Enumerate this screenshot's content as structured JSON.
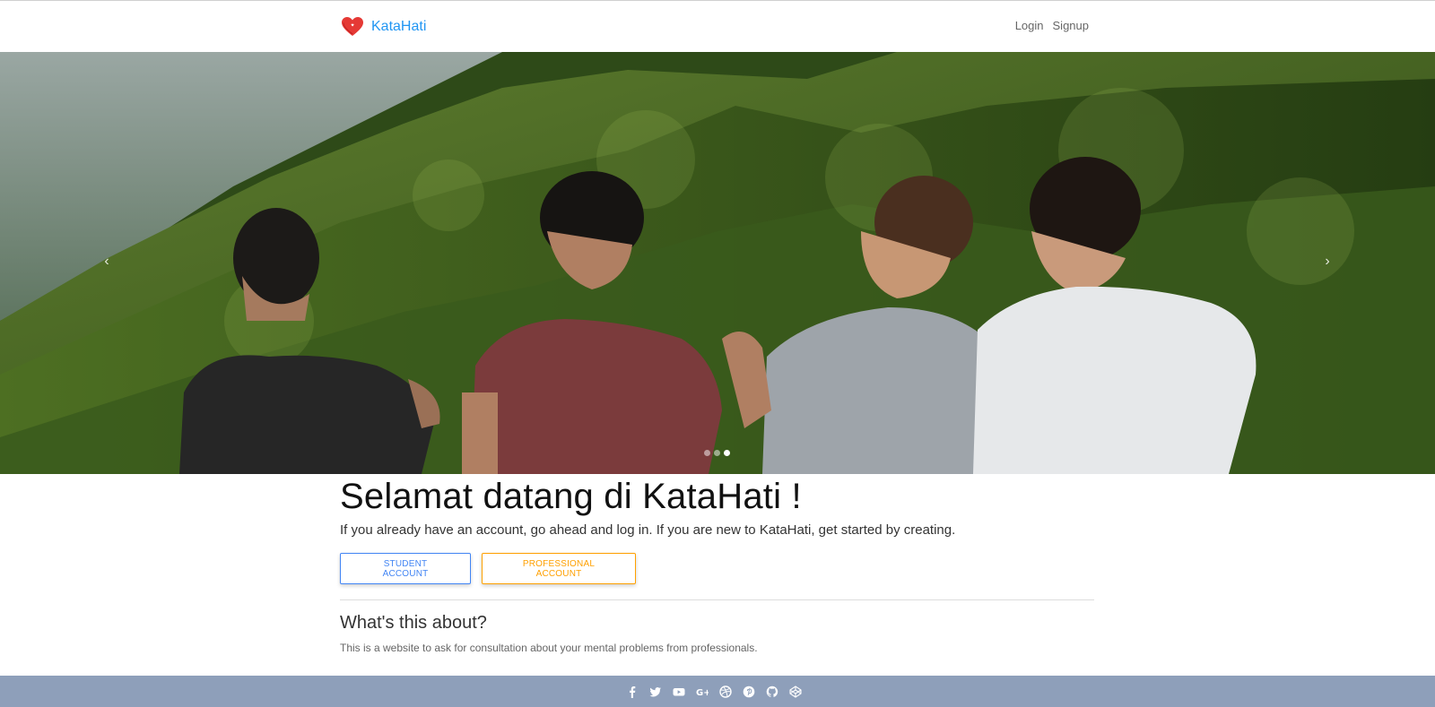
{
  "brand": {
    "name": "KataHati",
    "logo_icon": "heart-icon",
    "accent": "#2196f3"
  },
  "nav": {
    "login": "Login",
    "signup": "Signup"
  },
  "carousel": {
    "prev_icon": "‹",
    "next_icon": "›",
    "slide_count": 3,
    "active_slide": 3
  },
  "hero": {
    "headline": "Selamat datang di KataHati !",
    "lead": "If you already have an account, go ahead and log in. If you are new to KataHati, get started by creating.",
    "student_button": "Student account",
    "professional_button": "Professional account",
    "student_color": "#4285f4",
    "professional_color": "#ffa000"
  },
  "about": {
    "heading": "What's this about?",
    "text": "This is a website to ask for consultation about your mental problems from professionals."
  },
  "footer": {
    "background": "#8e9fba",
    "social_icons": [
      "facebook-icon",
      "twitter-icon",
      "youtube-icon",
      "google-plus-icon",
      "dribbble-icon",
      "pinterest-icon",
      "github-icon",
      "codepen-icon"
    ]
  }
}
